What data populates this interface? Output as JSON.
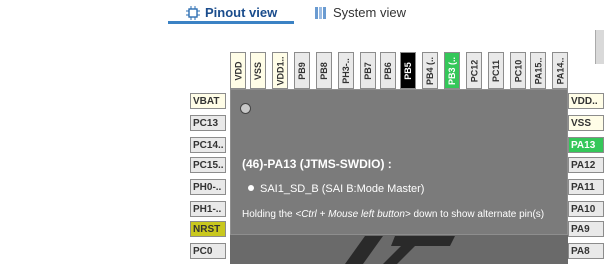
{
  "tabs": [
    {
      "label": "Pinout view",
      "icon": "chip-icon",
      "active": true
    },
    {
      "label": "System view",
      "icon": "system-grid-icon",
      "active": false
    }
  ],
  "top_pins": [
    "VDD",
    "VSS",
    "VDD1..",
    "PB9",
    "PB8",
    "PH3-..",
    "PB7",
    "PB6",
    "PB5",
    "PB4 (..",
    "PB3 (..",
    "PC12",
    "PC11",
    "PC10",
    "PA15..",
    "PA14.."
  ],
  "left_pins": [
    "VBAT",
    "PC13",
    "PC14..",
    "PC15..",
    "PH0-..",
    "PH1-..",
    "NRST",
    "PC0"
  ],
  "right_pins": [
    "VDD..",
    "VSS",
    "PA13",
    "PA12",
    "PA11",
    "PA10",
    "PA9",
    "PA8"
  ],
  "tooltip": {
    "title": "(46)-PA13 (JTMS-SWDIO) :",
    "mode": "SAI1_SD_B (SAI B:Mode Master)",
    "hint_prefix": "Holding the ",
    "hint_key": "<Ctrl + Mouse left button>",
    "hint_suffix": " down to show alternate pin(s)"
  },
  "colors": {
    "pin_default": "#fffde7",
    "pin_gray": "#e9e9e9",
    "pin_selected": "#34c759",
    "pin_black": "#000000",
    "pin_nrst": "#c9c81e",
    "chip_body": "#6a6a6a",
    "tab_accent": "#3b82c4"
  }
}
